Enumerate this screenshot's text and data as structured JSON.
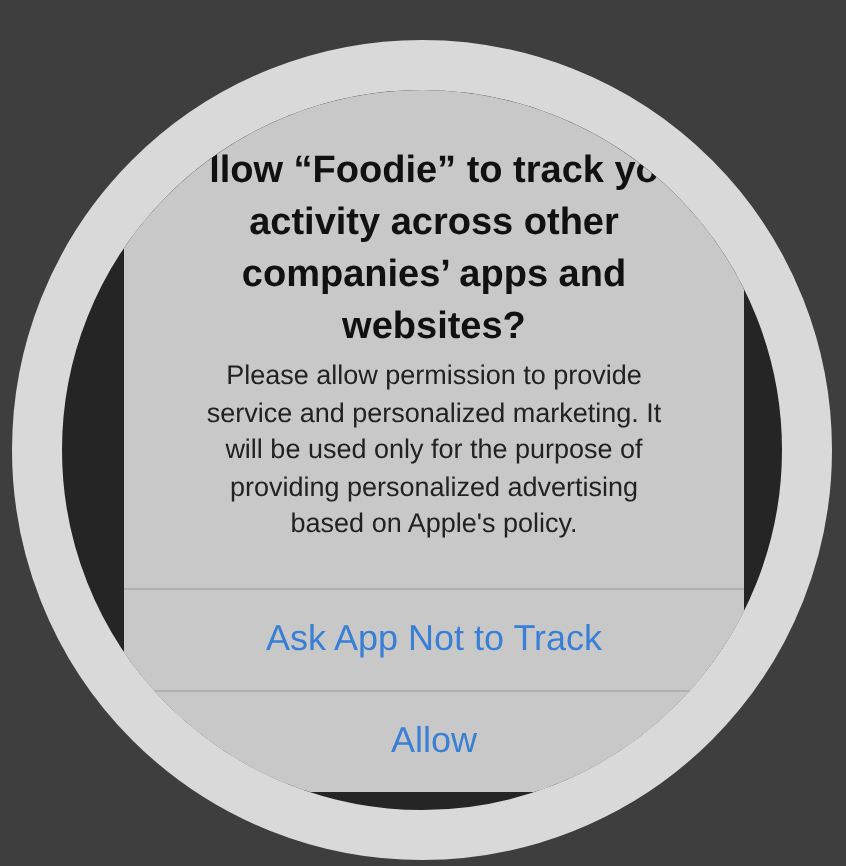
{
  "alert": {
    "title": "llow “Foodie” to track yo\nactivity across other\ncompanies’ apps and\nwebsites?",
    "message": "Please allow permission to provide\nservice and personalized marketing. It\nwill be used only for the purpose of\nproviding personalized advertising\nbased on Apple's policy.",
    "buttons": [
      {
        "label": "Ask App Not to Track"
      },
      {
        "label": "Allow"
      }
    ]
  }
}
